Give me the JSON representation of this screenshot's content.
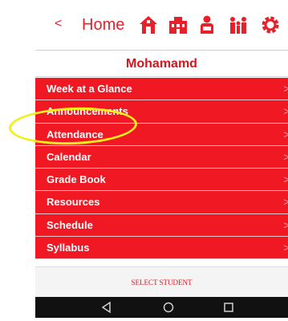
{
  "header": {
    "back_glyph": "<",
    "home_label": "Home",
    "icons": [
      "school-icon",
      "building-icon",
      "student-icon",
      "family-icon",
      "gear-icon"
    ]
  },
  "student": {
    "name": "Mohamamd"
  },
  "menu": {
    "items": [
      {
        "label": "Week at a Glance"
      },
      {
        "label": "Announcements"
      },
      {
        "label": "Attendance"
      },
      {
        "label": "Calendar"
      },
      {
        "label": "Grade Book"
      },
      {
        "label": "Resources"
      },
      {
        "label": "Schedule"
      },
      {
        "label": "Syllabus"
      }
    ],
    "chevron": ">"
  },
  "footer": {
    "select_label": "SELECT STUDENT"
  },
  "colors": {
    "accent": "#e8202a",
    "menu_bg": "#ef1823",
    "highlight": "#f2ee1a",
    "android_bar": "#111111"
  }
}
